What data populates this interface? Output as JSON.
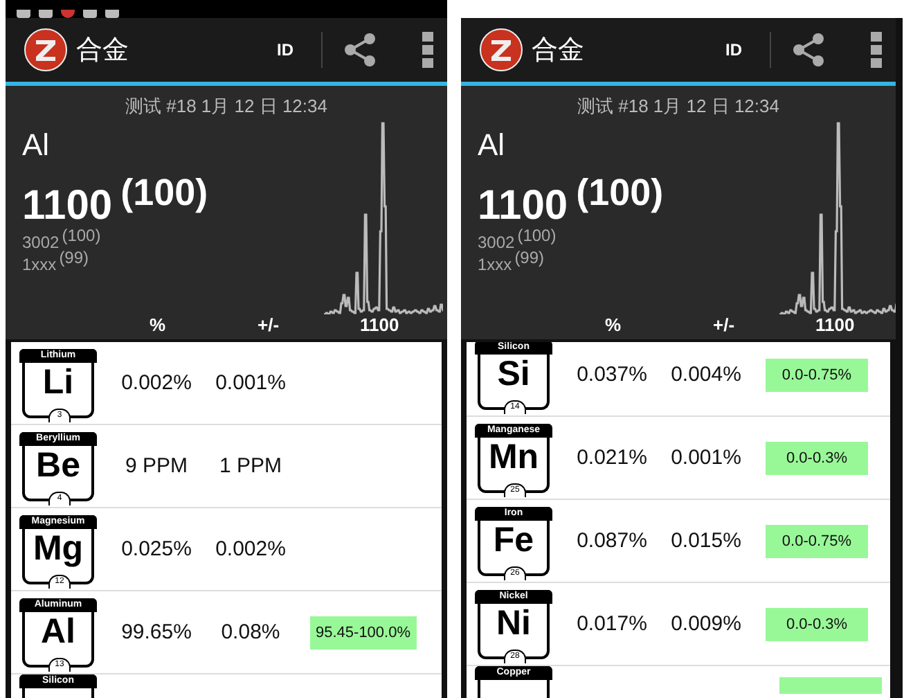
{
  "panels": [
    {
      "status_bar": true,
      "app_bar": {
        "title": "合金",
        "id_button": "ID"
      },
      "header": {
        "test_info": "测试 #18 1月 12 日 12:34",
        "base": "Al",
        "grade": "1100",
        "grade_match": "(100)",
        "alternatives": [
          {
            "grade": "3002",
            "match": "(100)"
          },
          {
            "grade": "1xxx",
            "match": "(99)"
          }
        ]
      },
      "columns": [
        "%",
        "+/-",
        "1100"
      ],
      "rows": [
        {
          "name": "Lithium",
          "symbol": "Li",
          "number": "3",
          "value": "0.002%",
          "error": "0.001%"
        },
        {
          "name": "Beryllium",
          "symbol": "Be",
          "number": "4",
          "value": "9 PPM",
          "error": "1 PPM"
        },
        {
          "name": "Magnesium",
          "symbol": "Mg",
          "number": "12",
          "value": "0.025%",
          "error": "0.002%"
        },
        {
          "name": "Aluminum",
          "symbol": "Al",
          "number": "13",
          "value": "99.65%",
          "error": "0.08%",
          "range": "95.45-100.0%"
        },
        {
          "name": "Silicon"
        }
      ]
    },
    {
      "app_bar": {
        "title": "合金",
        "id_button": "ID"
      },
      "header": {
        "test_info": "测试 #18 1月 12 日 12:34",
        "base": "Al",
        "grade": "1100",
        "grade_match": "(100)",
        "alternatives": [
          {
            "grade": "3002",
            "match": "(100)"
          },
          {
            "grade": "1xxx",
            "match": "(99)"
          }
        ]
      },
      "columns": [
        "%",
        "+/-",
        "1100"
      ],
      "scrolled": true,
      "rows": [
        {
          "name": "Silicon",
          "symbol": "Si",
          "number": "14",
          "value": "0.037%",
          "error": "0.004%",
          "range": "0.0-0.75%"
        },
        {
          "name": "Manganese",
          "symbol": "Mn",
          "number": "25",
          "value": "0.021%",
          "error": "0.001%",
          "range": "0.0-0.3%"
        },
        {
          "name": "Iron",
          "symbol": "Fe",
          "number": "26",
          "value": "0.087%",
          "error": "0.015%",
          "range": "0.0-0.75%"
        },
        {
          "name": "Nickel",
          "symbol": "Ni",
          "number": "28",
          "value": "0.017%",
          "error": "0.009%",
          "range": "0.0-0.3%"
        },
        {
          "name": "Copper",
          "range_partial": true
        }
      ]
    }
  ]
}
